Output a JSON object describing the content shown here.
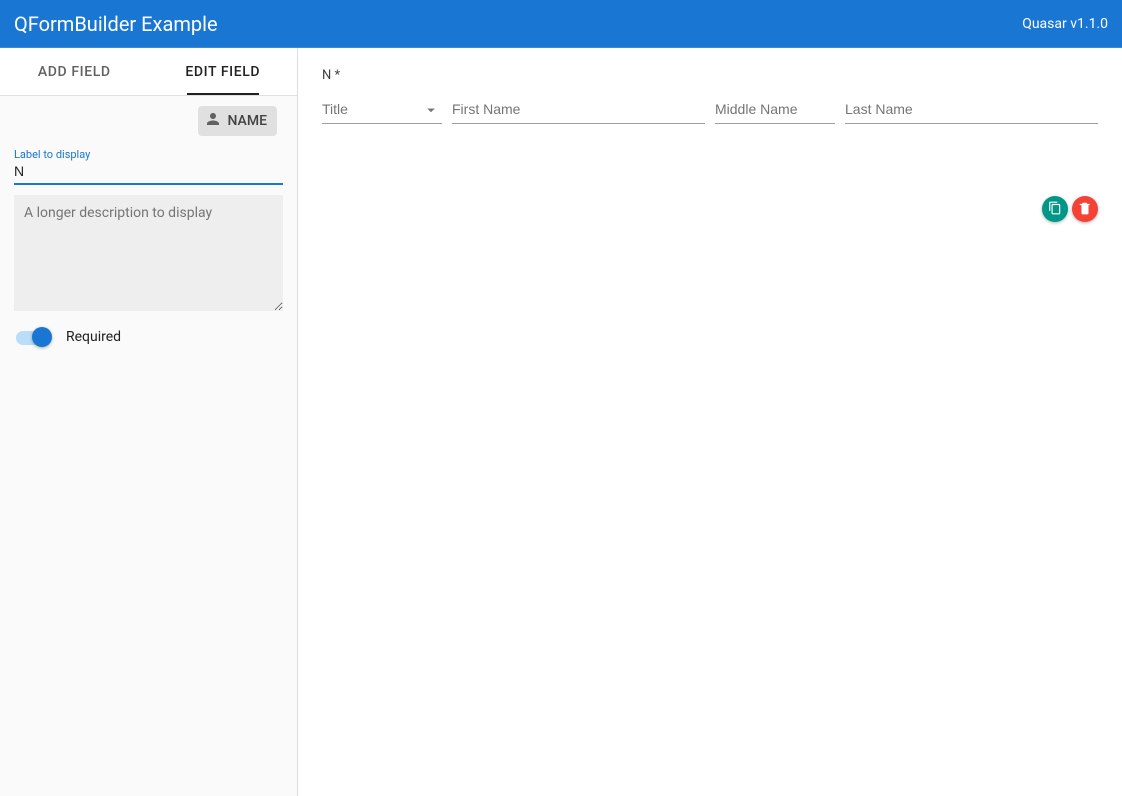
{
  "header": {
    "title": "QFormBuilder Example",
    "version": "Quasar v1.1.0"
  },
  "sidebar": {
    "tabs": {
      "add": "ADD FIELD",
      "edit": "EDIT FIELD"
    },
    "chip": {
      "label": "NAME",
      "icon": "person-icon"
    },
    "labelField": {
      "floating": "Label to display",
      "value": "N"
    },
    "descriptionField": {
      "placeholder": "A longer description to display",
      "value": ""
    },
    "requiredToggle": {
      "label": "Required",
      "on": true
    }
  },
  "preview": {
    "heading": "N *",
    "fields": {
      "title": {
        "placeholder": "Title"
      },
      "first": {
        "placeholder": "First Name"
      },
      "middle": {
        "placeholder": "Middle Name"
      },
      "last": {
        "placeholder": "Last Name"
      }
    },
    "actions": {
      "copy": "copy-icon",
      "delete": "delete-icon"
    }
  }
}
